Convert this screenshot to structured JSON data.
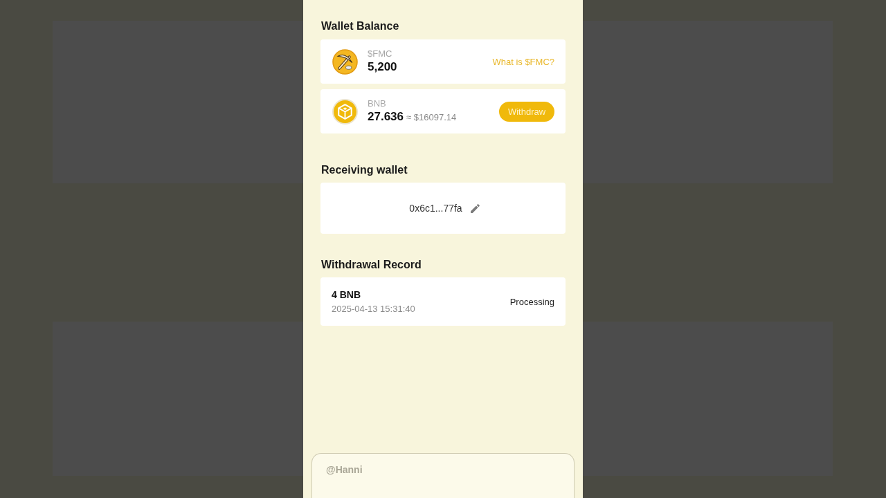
{
  "wallet_balance": {
    "title": "Wallet Balance",
    "assets": [
      {
        "kind": "fmc",
        "name": "$FMC",
        "amount": "5,200",
        "action": {
          "kind": "link",
          "label": "What is $FMC?"
        }
      },
      {
        "kind": "bnb",
        "name": "BNB",
        "amount": "27.636",
        "fiat": "≈ $16097.14",
        "action": {
          "kind": "button",
          "label": "Withdraw"
        }
      }
    ]
  },
  "receiving_wallet": {
    "title": "Receiving wallet",
    "address": "0x6c1...77fa"
  },
  "withdrawal_record": {
    "title": "Withdrawal Record",
    "records": [
      {
        "amount": "4 BNB",
        "time": "2025-04-13 15:31:40",
        "status": "Processing"
      }
    ]
  },
  "comment": {
    "placeholder": "@Hanni"
  }
}
